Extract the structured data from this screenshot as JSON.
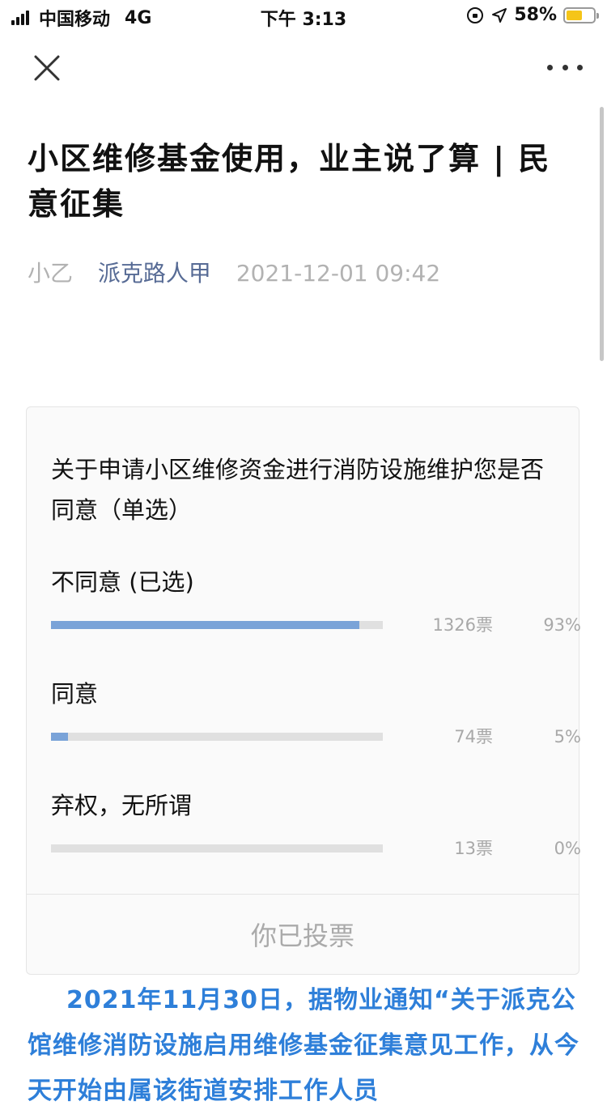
{
  "status_bar": {
    "carrier": "中国移动",
    "network": "4G",
    "time": "下午 3:13",
    "battery_percent": "58%",
    "battery_level": 0.58,
    "battery_color": "#f5c518"
  },
  "nav": {
    "close_icon": "close-icon",
    "more_icon": "more-icon"
  },
  "article": {
    "title": "小区维修基金使用，业主说了算 | 民意征集",
    "original_tag": "小乙",
    "account_name": "派克路人甲",
    "publish_time": "2021-12-01 09:42",
    "body_text": "2021年11月30日，据物业通知“关于派克公馆维修消防设施启用维修基金征集意见工作，从今天开始由属该街道安排工作人员"
  },
  "vote": {
    "question": "关于申请小区维修资金进行消防设施维护您是否同意（单选）",
    "options": [
      {
        "label": "不同意 (已选)",
        "votes": "1326票",
        "percent": "93%",
        "fraction": 0.93
      },
      {
        "label": "同意",
        "votes": "74票",
        "percent": "5%",
        "fraction": 0.05
      },
      {
        "label": "弃权，无所谓",
        "votes": "13票",
        "percent": "0%",
        "fraction": 0.0
      }
    ],
    "footer": "你已投票",
    "bar_color": "#7aa3d8",
    "track_color": "#e0e0e0"
  },
  "colors": {
    "account_link": "#576b95",
    "body_text": "#2e7fd9"
  }
}
